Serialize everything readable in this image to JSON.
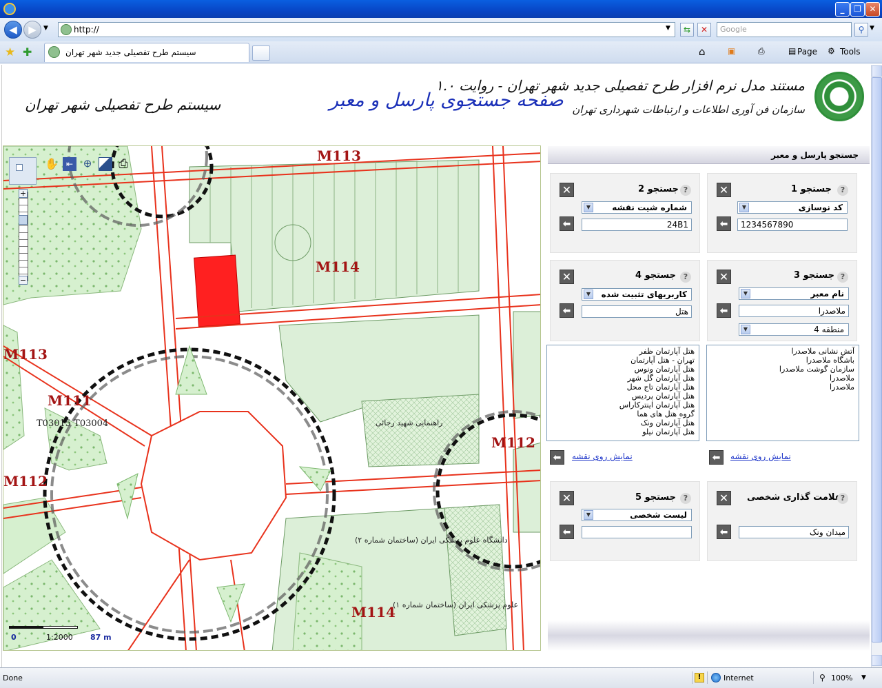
{
  "browser": {
    "address": "http://",
    "search_placeholder": "Google",
    "tab_title": "سیستم طرح تفصیلی جدید شهر تهران",
    "page_menu": "Page",
    "tools_menu": "Tools"
  },
  "header": {
    "line1": "مستند مدل نرم افزار طرح تفصیلی جدید شهر تهران - روایت ۱.۰",
    "line2": "سازمان فن آوری اطلاعات و ارتباطات شهرداری تهران",
    "center_title": "صفحه جستجوی پارسل و معبر",
    "left_title": "سیستم طرح تفصیلی شهر تهران"
  },
  "map": {
    "scale_min": "0",
    "scale_ratio": "1:2000",
    "scale_max": "87 m",
    "labels": {
      "m113_top": "M113",
      "m114_center": "M114",
      "m113_left": "M113",
      "m111": "M111",
      "t_codes": "T03015  T03004",
      "m112_left": "M112",
      "m112_right": "M112",
      "m114_bottom": "M114",
      "uni1": "دانشگاه علوم پزشکی ایران (ساختمان شماره ۲)",
      "uni2": "علوم پزشکی ایران (ساختمان شماره ۱)",
      "police": "راهنمایی شهید رجائی"
    }
  },
  "panel": {
    "title": "جستجو پارسل و معبر",
    "search1": {
      "title": "جستجو 1",
      "select": "کد نوسازی",
      "value": "1234567890"
    },
    "search2": {
      "title": "جستجو 2",
      "select": "شماره شیت نقشه",
      "value": "24B1"
    },
    "search3": {
      "title": "جستجو 3",
      "select": "نام معبر",
      "value": "ملاصدرا",
      "district": "منطقه 4"
    },
    "search4": {
      "title": "جستجو 4",
      "select": "کاربریهای تثبیت شده",
      "value": "هتل"
    },
    "results3": [
      "آتش نشانی  ملاصدرا",
      "باشگاه ملاصدرا",
      "سازمان گوشت  ملاصدرا",
      "ملاصدرا",
      "ملاصدرا"
    ],
    "results4": [
      "هتل آپارتمان ظفر",
      "تهران - هتل آپارتمان",
      "هتل آپارتمان ونوس",
      "هتل آپارتمان گل شهر",
      "هتل آپارتمان تاج محل",
      "هتل آپارتمان پردیس",
      "هتل آپارتمان اینترکاراس",
      "گروه هتل های هما",
      "هتل آپارتمان ونک",
      "هتل آپارتمان نیلو"
    ],
    "show_on_map": "نمایش روی نقشه",
    "bookmark": {
      "title": "علامت گذاری شخصی",
      "value": "میدان ونک"
    },
    "search5": {
      "title": "جستجو 5",
      "select": "لیست شخصی",
      "value": ""
    }
  },
  "status": {
    "left": "Done",
    "zone": "Internet",
    "zoom": "100%"
  }
}
